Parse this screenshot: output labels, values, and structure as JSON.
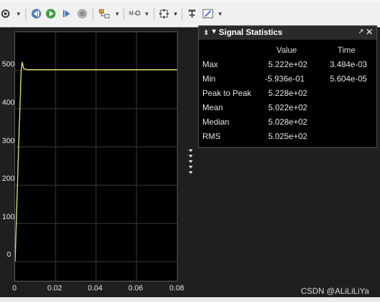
{
  "toolbar": {
    "icons": [
      "gear-icon",
      "step-back-icon",
      "run-icon",
      "step-forward-icon",
      "stop-icon",
      "layout-icon",
      "zoom-icon",
      "fit-icon",
      "cursor-measure-icon",
      "edit-icon"
    ]
  },
  "plot": {
    "y_ticks": [
      "500",
      "400",
      "300",
      "200",
      "100",
      "0"
    ],
    "x_ticks": [
      "0",
      "0.02",
      "0.04",
      "0.06",
      "0.08"
    ],
    "line_color": "#e6e653"
  },
  "chart_data": {
    "type": "line",
    "title": "",
    "xlabel": "",
    "ylabel": "",
    "xlim": [
      0,
      0.08
    ],
    "ylim": [
      -50,
      600
    ],
    "series": [
      {
        "x": [
          0,
          0.0015,
          0.003,
          0.0035,
          0.0042,
          0.006,
          0.01,
          0.02,
          0.04,
          0.06,
          0.08
        ],
        "y": [
          0,
          260,
          500,
          522,
          505,
          502,
          502,
          502,
          502,
          502,
          502
        ]
      }
    ]
  },
  "stats": {
    "title": "Signal Statistics",
    "columns": [
      "Value",
      "Time"
    ],
    "rows": [
      {
        "label": "Max",
        "value": "5.222e+02",
        "time": "3.484e-03"
      },
      {
        "label": "Min",
        "value": "-5.936e-01",
        "time": "5.604e-05"
      },
      {
        "label": "Peak to Peak",
        "value": "5.228e+02",
        "time": ""
      },
      {
        "label": "Mean",
        "value": "5.022e+02",
        "time": ""
      },
      {
        "label": "Median",
        "value": "5.028e+02",
        "time": ""
      },
      {
        "label": "RMS",
        "value": "5.025e+02",
        "time": ""
      }
    ]
  },
  "watermark": "CSDN @ALiLiLiYa"
}
